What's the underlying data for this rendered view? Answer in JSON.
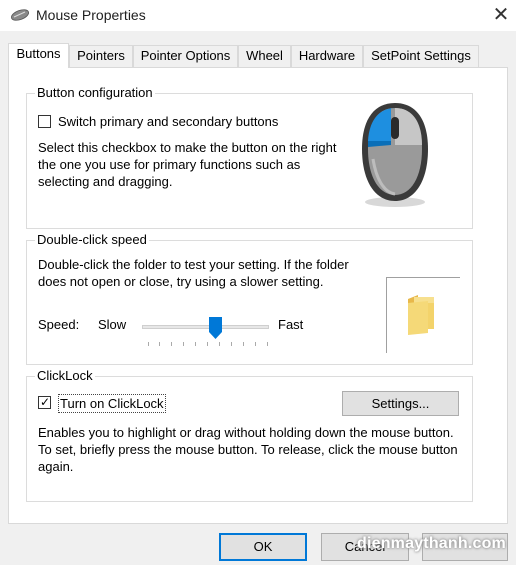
{
  "window": {
    "title": "Mouse Properties",
    "close_symbol": "✕"
  },
  "tabs": [
    {
      "label": "Buttons",
      "active": true
    },
    {
      "label": "Pointers",
      "active": false
    },
    {
      "label": "Pointer Options",
      "active": false
    },
    {
      "label": "Wheel",
      "active": false
    },
    {
      "label": "Hardware",
      "active": false
    },
    {
      "label": "SetPoint Settings",
      "active": false
    }
  ],
  "button_config": {
    "heading": "Button configuration",
    "switch_label": "Switch primary and secondary buttons",
    "switch_checked": false,
    "description": "Select this checkbox to make the button on the right the one you use for primary functions such as selecting and dragging."
  },
  "double_click": {
    "heading": "Double-click speed",
    "description": "Double-click the folder to test your setting. If the folder does not open or close, try using a slower setting.",
    "speed_label": "Speed:",
    "slow_label": "Slow",
    "fast_label": "Fast",
    "slider_value": 0.6
  },
  "clicklock": {
    "heading": "ClickLock",
    "toggle_label": "Turn on ClickLock",
    "toggle_checked": true,
    "settings_button": "Settings...",
    "description": "Enables you to highlight or drag without holding down the mouse button. To set, briefly press the mouse button. To release, click the mouse button again."
  },
  "footer": {
    "ok_label": "OK",
    "cancel_label": "Cancel",
    "watermark": "dienmaythanh.com"
  },
  "icons": {
    "title": "mouse-icon",
    "illustration": "mouse-illustration",
    "folder": "folder-icon"
  },
  "colors": {
    "accent": "#0078d7",
    "folder": "#f3d36b"
  }
}
